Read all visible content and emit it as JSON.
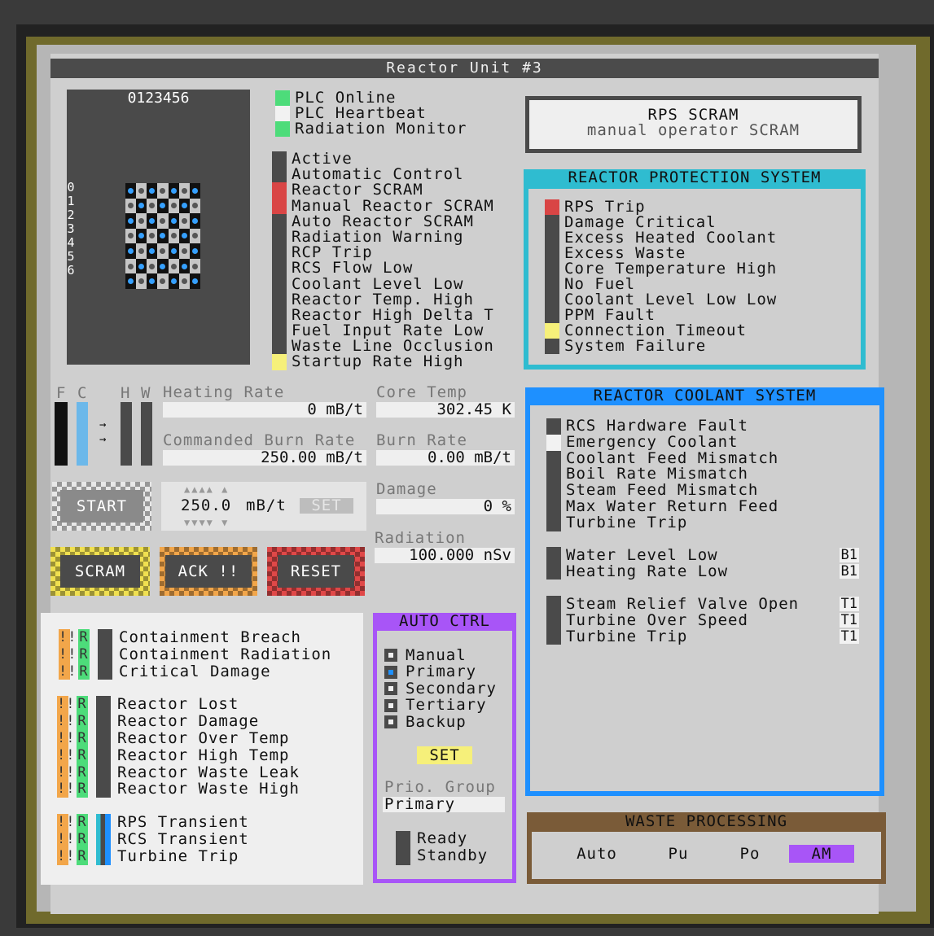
{
  "title": "Reactor Unit #3",
  "core_map": {
    "x_axis": "0123456",
    "y_axis": [
      "0",
      "1",
      "2",
      "3",
      "4",
      "5",
      "6"
    ]
  },
  "status": [
    {
      "label": "PLC Online",
      "color": "#4ddc7a"
    },
    {
      "label": "PLC Heartbeat",
      "color": "#f2f2f2"
    },
    {
      "label": "Radiation Monitor",
      "color": "#4ddc7a"
    }
  ],
  "reactor_flags": [
    {
      "label": "Active",
      "color": "#4a4a4a"
    },
    {
      "label": "Automatic Control",
      "color": "#4a4a4a"
    },
    {
      "label": "Reactor SCRAM",
      "color": "#d94545"
    },
    {
      "label": "Manual Reactor SCRAM",
      "color": "#d94545"
    },
    {
      "label": "Auto Reactor SCRAM",
      "color": "#4a4a4a"
    },
    {
      "label": "Radiation Warning",
      "color": "#4a4a4a"
    },
    {
      "label": "RCP Trip",
      "color": "#4a4a4a"
    },
    {
      "label": "RCS Flow Low",
      "color": "#4a4a4a"
    },
    {
      "label": "Coolant  Level Low",
      "color": "#4a4a4a"
    },
    {
      "label": "Reactor Temp. High",
      "color": "#4a4a4a"
    },
    {
      "label": "Reactor High Delta T",
      "color": "#4a4a4a"
    },
    {
      "label": "Fuel Input Rate Low",
      "color": "#4a4a4a"
    },
    {
      "label": "Waste Line Occlusion",
      "color": "#4a4a4a"
    },
    {
      "label": "Startup Rate High",
      "color": "#f6f07a"
    }
  ],
  "rps_scram": {
    "title": "RPS SCRAM",
    "subtitle": "manual operator SCRAM"
  },
  "rps": {
    "title": "REACTOR PROTECTION SYSTEM",
    "items": [
      {
        "label": "RPS Trip",
        "color": "#d94545"
      },
      {
        "label": "Damage Critical",
        "color": "#4a4a4a"
      },
      {
        "label": "Excess Heated Coolant",
        "color": "#4a4a4a"
      },
      {
        "label": "Excess Waste",
        "color": "#4a4a4a"
      },
      {
        "label": "Core Temperature High",
        "color": "#4a4a4a"
      },
      {
        "label": "No Fuel",
        "color": "#4a4a4a"
      },
      {
        "label": "Coolant Level Low Low",
        "color": "#4a4a4a"
      },
      {
        "label": "PPM Fault",
        "color": "#4a4a4a"
      },
      {
        "label": "Connection Timeout",
        "color": "#f6f07a"
      },
      {
        "label": "System Failure",
        "color": "#4a4a4a"
      }
    ]
  },
  "bars": {
    "labels": [
      "F",
      "C",
      "H",
      "W"
    ],
    "arrows": [
      "→",
      "→"
    ]
  },
  "fields": {
    "heating_rate": {
      "label": "Heating Rate",
      "value": "0 mB/t"
    },
    "core_temp": {
      "label": "Core Temp",
      "value": "302.45 K"
    },
    "commanded_burn": {
      "label": "Commanded Burn Rate",
      "value": "250.00 mB/t"
    },
    "burn_rate": {
      "label": "Burn Rate",
      "value": "0.00 mB/t"
    },
    "damage": {
      "label": "Damage",
      "value": "0 %"
    },
    "radiation": {
      "label": "Radiation",
      "value": "100.000 nSv"
    }
  },
  "controls": {
    "start": "START",
    "burn_value": "250.0",
    "burn_unit": "mB/t",
    "set": "SET",
    "up_arrows": "▲▲▲▲ ▲",
    "down_arrows": "▼▼▼▼ ▼",
    "scram": "SCRAM",
    "ack": "ACK !!",
    "reset": "RESET"
  },
  "alarms": {
    "bang": "!!",
    "r": "R",
    "groups": [
      [
        "Containment Breach",
        "Containment Radiation",
        "Critical Damage"
      ],
      [
        "Reactor Lost",
        "Reactor Damage",
        "Reactor Over Temp",
        "Reactor High Temp",
        "Reactor Waste Leak",
        "Reactor Waste High"
      ],
      [
        "RPS Transient",
        "RCS Transient",
        "Turbine Trip"
      ]
    ]
  },
  "auto_ctrl": {
    "title": "AUTO CTRL",
    "options": [
      "Manual",
      "Primary",
      "Secondary",
      "Tertiary",
      "Backup"
    ],
    "selected": 1,
    "set": "SET",
    "prio_label": "Prio. Group",
    "prio_value": "Primary",
    "ready": "Ready",
    "standby": "Standby"
  },
  "rcs": {
    "title": "REACTOR COOLANT SYSTEM",
    "group1": [
      {
        "label": "RCS Hardware Fault",
        "color": "#4a4a4a"
      },
      {
        "label": "Emergency Coolant",
        "color": "#f2f2f2"
      },
      {
        "label": "Coolant Feed Mismatch",
        "color": "#4a4a4a"
      },
      {
        "label": "Boil Rate Mismatch",
        "color": "#4a4a4a"
      },
      {
        "label": "Steam Feed Mismatch",
        "color": "#4a4a4a"
      },
      {
        "label": "Max Water Return Feed",
        "color": "#4a4a4a"
      },
      {
        "label": "Turbine Trip",
        "color": "#4a4a4a"
      }
    ],
    "group2": [
      {
        "label": "Water Level Low",
        "tag": "B1"
      },
      {
        "label": "Heating Rate Low",
        "tag": "B1"
      }
    ],
    "group3": [
      {
        "label": "Steam Relief Valve Open",
        "tag": "T1"
      },
      {
        "label": "Turbine Over Speed",
        "tag": "T1"
      },
      {
        "label": "Turbine Trip",
        "tag": "T1"
      }
    ]
  },
  "waste": {
    "title": "WASTE PROCESSING",
    "options": [
      "Auto",
      "Pu",
      "Po",
      "AM"
    ],
    "selected": 3
  }
}
